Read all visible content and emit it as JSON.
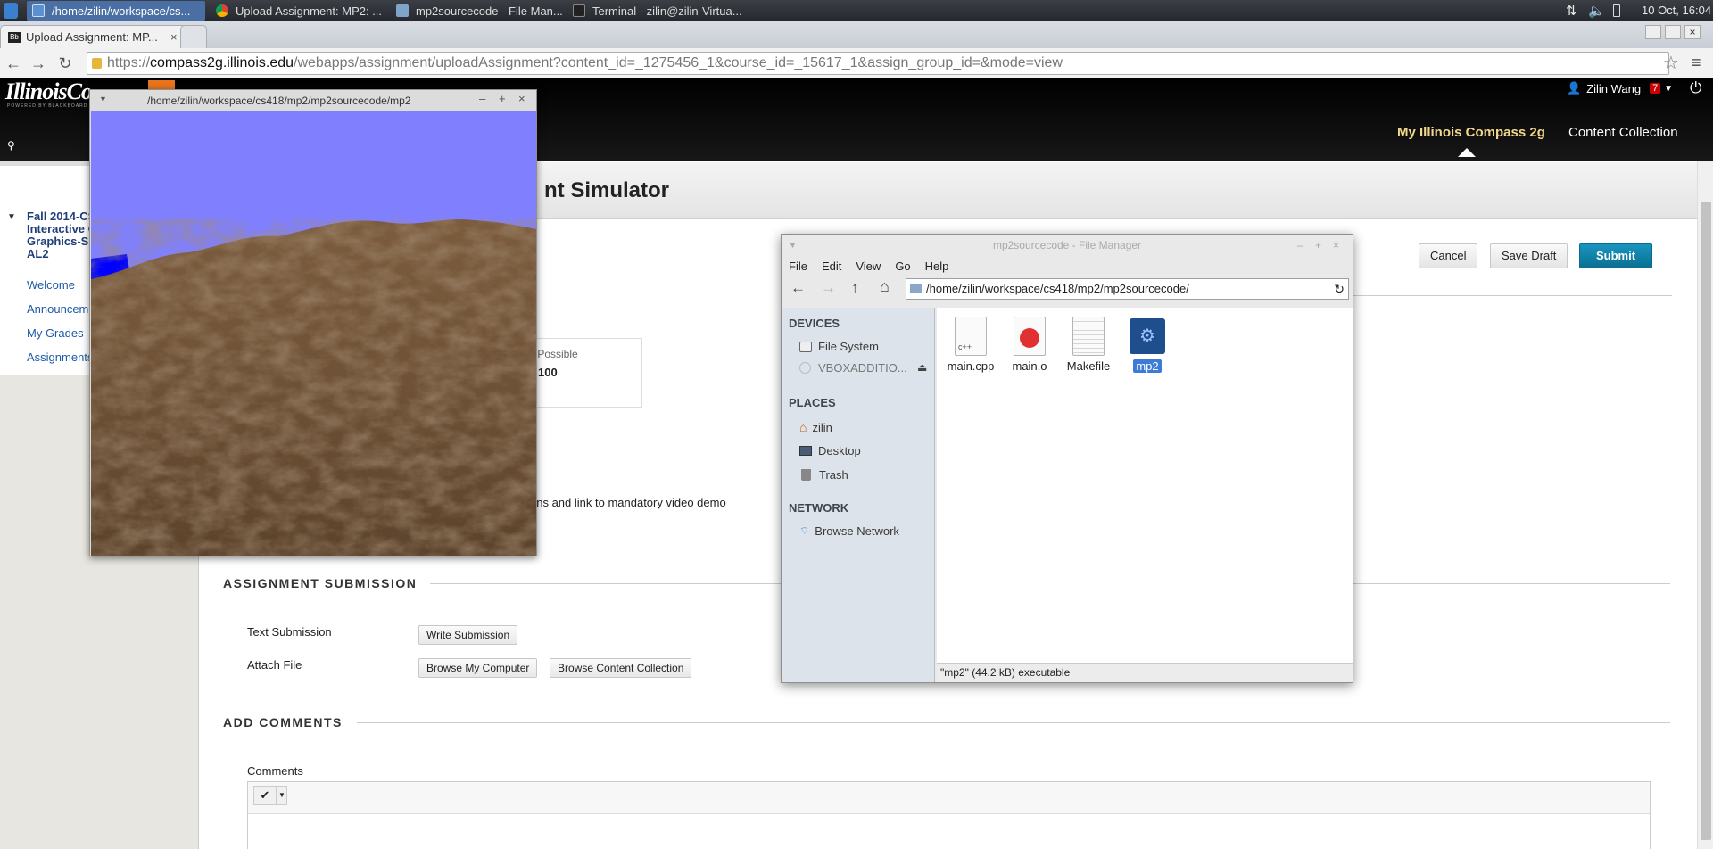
{
  "taskbar": {
    "tasks": [
      {
        "label": "/home/zilin/workspace/cs...",
        "active": true
      },
      {
        "label": "Upload Assignment: MP2: ..."
      },
      {
        "label": "mp2sourcecode - File Man..."
      },
      {
        "label": "Terminal - zilin@zilin-Virtua..."
      }
    ],
    "clock": "10 Oct, 16:04"
  },
  "browser": {
    "tab_title": "Upload Assignment: MP...",
    "url_scheme": "https://",
    "url_host": "compass2g.illinois.edu",
    "url_path": "/webapps/assignment/uploadAssignment?content_id=_1275456_1&course_id=_15617_1&assign_group_id=&mode=view"
  },
  "header": {
    "logo": "IllinoisCo",
    "logo_sub": "POWERED BY BLACKBOARD",
    "user_name": "Zilin Wang",
    "notification_count": "7",
    "nav": [
      "My Illinois Compass 2g",
      "Content Collection"
    ]
  },
  "course_menu": {
    "course_title_lines": [
      "Fall 2014-CS",
      "Interactive C",
      "Graphics-Se",
      "AL2"
    ],
    "items": [
      "Welcome",
      "Announceme",
      "My Grades",
      "Assignments"
    ]
  },
  "page": {
    "title": "nt Simulator",
    "actions": {
      "cancel": "Cancel",
      "save_draft": "Save Draft",
      "submit": "Submit"
    },
    "points_label": "s Possible",
    "points_value": "100",
    "instructions_fragment": "ons and link to mandatory video demo",
    "assignment_submission_heading": "ASSIGNMENT SUBMISSION",
    "text_submission_label": "Text Submission",
    "write_submission_button": "Write Submission",
    "attach_file_label": "Attach File",
    "browse_computer_button": "Browse My Computer",
    "browse_content_button": "Browse Content Collection",
    "add_comments_heading": "ADD COMMENTS",
    "comments_label": "Comments"
  },
  "gl_window": {
    "title": "/home/zilin/workspace/cs418/mp2/mp2sourcecode/mp2"
  },
  "file_manager": {
    "title": "mp2sourcecode - File Manager",
    "menu": [
      "File",
      "Edit",
      "View",
      "Go",
      "Help"
    ],
    "path": "/home/zilin/workspace/cs418/mp2/mp2sourcecode/",
    "devices_heading": "DEVICES",
    "devices": [
      "File System",
      "VBOXADDITIO..."
    ],
    "places_heading": "PLACES",
    "places": [
      "zilin",
      "Desktop",
      "Trash"
    ],
    "network_heading": "NETWORK",
    "network": [
      "Browse Network"
    ],
    "files": [
      {
        "name": "main.cpp",
        "icon": "cpp-file-icon",
        "badge": "c++"
      },
      {
        "name": "main.o",
        "icon": "object-file-icon"
      },
      {
        "name": "Makefile",
        "icon": "makefile-icon"
      },
      {
        "name": "mp2",
        "icon": "executable-icon",
        "selected": true
      }
    ],
    "status": "\"mp2\" (44.2 kB) executable"
  },
  "colors": {
    "submit": "#0e7fa6",
    "sky": "#8080ff",
    "selection": "#3d7bd6"
  }
}
